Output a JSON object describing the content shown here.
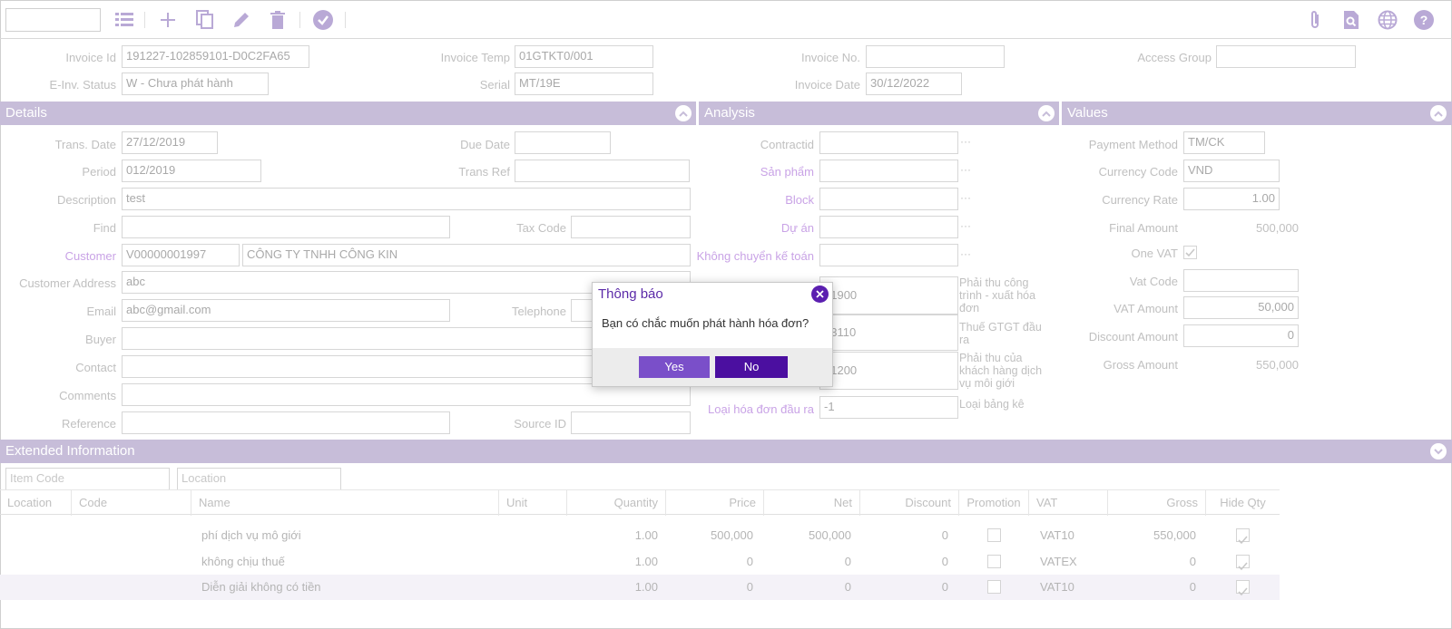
{
  "header": {
    "invoice_id": {
      "label": "Invoice Id",
      "value": "191227-102859101-D0C2FA65"
    },
    "invoice_temp": {
      "label": "Invoice Temp",
      "value": "01GTKT0/001"
    },
    "invoice_no": {
      "label": "Invoice No.",
      "value": ""
    },
    "access_group": {
      "label": "Access Group",
      "value": ""
    },
    "einv_status": {
      "label": "E-Inv. Status",
      "value": "W - Chưa phát hành"
    },
    "serial": {
      "label": "Serial",
      "value": "MT/19E"
    },
    "invoice_date": {
      "label": "Invoice Date",
      "value": "30/12/2022"
    }
  },
  "sections": {
    "details": "Details",
    "analysis": "Analysis",
    "values": "Values",
    "extended": "Extended Information"
  },
  "details": {
    "trans_date": {
      "label": "Trans. Date",
      "value": "27/12/2019"
    },
    "due_date": {
      "label": "Due Date",
      "value": ""
    },
    "period": {
      "label": "Period",
      "value": "012/2019"
    },
    "trans_ref": {
      "label": "Trans Ref",
      "value": ""
    },
    "description": {
      "label": "Description",
      "value": "test"
    },
    "find": {
      "label": "Find",
      "value": ""
    },
    "tax_code": {
      "label": "Tax Code",
      "value": ""
    },
    "customer": {
      "label": "Customer",
      "code": "V00000001997",
      "name": "CÔNG TY TNHH CÔNG KIN"
    },
    "customer_address": {
      "label": "Customer Address",
      "value": "abc"
    },
    "email": {
      "label": "Email",
      "value": "abc@gmail.com"
    },
    "telephone": {
      "label": "Telephone",
      "value": ""
    },
    "buyer": {
      "label": "Buyer",
      "value": ""
    },
    "contact": {
      "label": "Contact",
      "value": ""
    },
    "comments": {
      "label": "Comments",
      "value": ""
    },
    "reference": {
      "label": "Reference",
      "value": ""
    },
    "source_id": {
      "label": "Source ID",
      "value": ""
    }
  },
  "analysis": {
    "contractid": {
      "label": "Contractid",
      "value": ""
    },
    "san_pham": {
      "label": "Sản phẩm",
      "value": ""
    },
    "block": {
      "label": "Block",
      "value": ""
    },
    "du_an": {
      "label": "Dự án",
      "value": ""
    },
    "khong_chuyen": {
      "label": "Không chuyển kế toán",
      "value": ""
    },
    "acc1": {
      "value": "31900",
      "desc": "Phải thu công trình - xuất hóa đơn"
    },
    "acc2": {
      "value": "33110",
      "desc": "Thuế GTGT đầu ra"
    },
    "acc3": {
      "value": "31200",
      "desc": "Phải thu của khách hàng dịch vụ môi giới"
    },
    "loai_hd": {
      "label": "Loại hóa đơn đầu ra",
      "value": "-1",
      "desc": "Loại bảng kê"
    },
    "dots": "···"
  },
  "values": {
    "payment_method": {
      "label": "Payment Method",
      "value": "TM/CK"
    },
    "currency_code": {
      "label": "Currency Code",
      "value": "VND"
    },
    "currency_rate": {
      "label": "Currency Rate",
      "value": "1.00"
    },
    "final_amount": {
      "label": "Final Amount",
      "value": "500,000"
    },
    "one_vat": {
      "label": "One VAT",
      "checked": true
    },
    "vat_code": {
      "label": "Vat Code",
      "value": ""
    },
    "vat_amount": {
      "label": "VAT Amount",
      "value": "50,000"
    },
    "discount_amount": {
      "label": "Discount Amount",
      "value": "0"
    },
    "gross_amount": {
      "label": "Gross Amount",
      "value": "550,000"
    }
  },
  "extended": {
    "item_code_placeholder": "Item Code",
    "location_placeholder": "Location"
  },
  "grid": {
    "columns": [
      "Location",
      "Code",
      "Name",
      "Unit",
      "Quantity",
      "Price",
      "Net",
      "Discount",
      "Promotion",
      "VAT",
      "Gross",
      "Hide Qty"
    ],
    "rows": [
      {
        "name": "phí dịch vụ mô giới",
        "quantity": "1.00",
        "price": "500,000",
        "net": "500,000",
        "discount": "0",
        "vat": "VAT10",
        "gross": "550,000"
      },
      {
        "name": "không chịu thuế",
        "quantity": "1.00",
        "price": "0",
        "net": "0",
        "discount": "0",
        "vat": "VATEX",
        "gross": "0"
      },
      {
        "name": "Diễn giải không có tiền",
        "quantity": "1.00",
        "price": "0",
        "net": "0",
        "discount": "0",
        "vat": "VAT10",
        "gross": "0"
      }
    ]
  },
  "modal": {
    "title": "Thông báo",
    "message": "Bạn có chắc muốn phát hành hóa đơn?",
    "yes": "Yes",
    "no": "No"
  },
  "colors": {
    "accent": "#5b1fb0",
    "section_bar": "#c7bdd9",
    "icon": "#b9a9d6"
  }
}
